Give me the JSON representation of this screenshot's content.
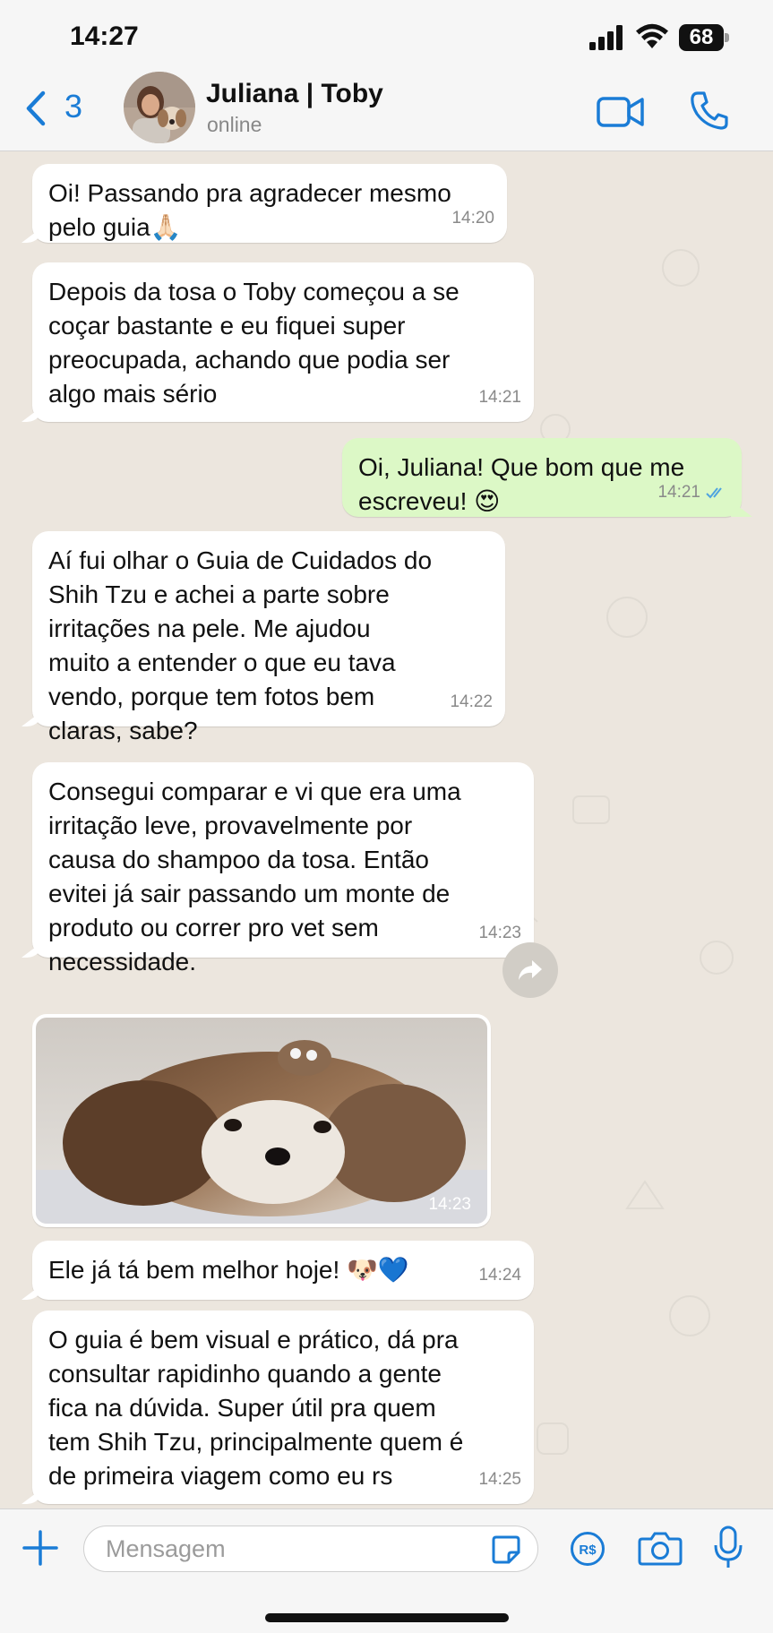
{
  "status_bar": {
    "time": "14:27",
    "battery": "68"
  },
  "header": {
    "back_count": "3",
    "contact_name": "Juliana | Toby",
    "contact_status": "online"
  },
  "messages": [
    {
      "direction": "in",
      "text": "Oi! Passando pra agradecer mesmo\npelo guia🙏🏻",
      "time": "14:20"
    },
    {
      "direction": "in",
      "text": "Depois da tosa o Toby começou a se\ncoçar bastante e eu fiquei super\npreocupada, achando que podia ser\nalgo mais sério",
      "time": "14:21"
    },
    {
      "direction": "out",
      "text": "Oi, Juliana! Que bom que me\nescreveu! 😍",
      "time": "14:21",
      "status": "read"
    },
    {
      "direction": "in",
      "text": "Aí fui olhar o Guia de Cuidados do\nShih Tzu e achei a parte sobre\nirritações na pele. Me ajudou\nmuito a entender o que eu tava\nvendo, porque tem fotos bem\nclaras, sabe?",
      "time": "14:22"
    },
    {
      "direction": "in",
      "text": "Consegui comparar e vi que era uma\nirritação leve, provavelmente por\ncausa do shampoo da tosa. Então\nevitei já sair passando um monte de\nproduto ou correr pro vet sem\nnecessidade.",
      "time": "14:23"
    },
    {
      "direction": "in",
      "type": "image",
      "time": "14:23"
    },
    {
      "direction": "in",
      "text": "Ele já tá bem melhor hoje! 🐶💙",
      "time": "14:24"
    },
    {
      "direction": "in",
      "text": "O guia é bem visual e prático, dá pra\nconsultar rapidinho quando a gente\nfica na dúvida. Super útil pra quem\ntem Shih Tzu, principalmente quem é\nde primeira viagem como eu rs",
      "time": "14:25"
    }
  ],
  "input": {
    "placeholder": "Mensagem",
    "value": ""
  },
  "colors": {
    "accent": "#1a7cd6",
    "chat_background": "#ece6de",
    "incoming_bubble": "#ffffff",
    "outgoing_bubble": "#dcf8c6",
    "read_ticks": "#4fa3e0"
  },
  "icons": [
    "back-chevron-icon",
    "video-call-icon",
    "phone-call-icon",
    "forward-icon",
    "plus-icon",
    "sticker-icon",
    "pay-icon",
    "camera-icon",
    "microphone-icon"
  ]
}
